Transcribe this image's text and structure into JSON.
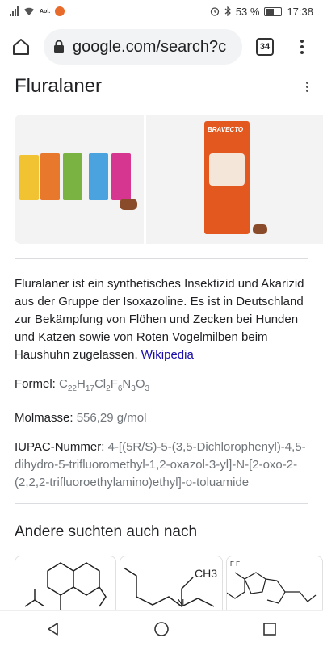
{
  "status_bar": {
    "carrier_badge": "Aol.",
    "battery_percent": "53 %",
    "battery_level": 0.53,
    "time": "17:38"
  },
  "browser": {
    "url": "google.com/search?c",
    "tab_count": "34",
    "icons": [
      "home-icon",
      "lock-icon",
      "menu-icon"
    ]
  },
  "knowledge_panel": {
    "title": "Fluralaner",
    "images": [
      {
        "name": "bravecto-product-lineup-image"
      },
      {
        "name": "bravecto-box-image",
        "brand_text": "BRAVECTO"
      }
    ],
    "description": "Fluralaner ist ein synthetisches Insektizid und Akarizid aus der Gruppe der Isoxazoline. Es ist in Deutschland zur Bekämpfung von Flöhen und Zecken bei Hunden und Katzen sowie von Roten Vogelmilben beim Haushuhn zugelassen.",
    "source_link": "Wikipedia",
    "facts": {
      "formula_label": "Formel:",
      "formula": {
        "C": "C",
        "C_n": "22",
        "H": "H",
        "H_n": "17",
        "Cl": "Cl",
        "Cl_n": "2",
        "F": "F",
        "F_n": "6",
        "N": "N",
        "N_n": "3",
        "O": "O",
        "O_n": "3"
      },
      "molmass_label": "Molmasse:",
      "molmass": "556,29 g/mol",
      "iupac_label": "IUPAC-Nummer:",
      "iupac": "4-[(5R/S)-5-(3,5-Dichlorophenyl)-4,5-dihydro-5-trifluoromethyl-1,2-oxazol-3-yl]-N-[2-oxo-2-(2,2,2-trifluoroethylamino)ethyl]-o-toluamide"
    },
    "related_title": "Andere suchten auch nach",
    "related_labels": {
      "ch3": "CH3",
      "mol3_atoms": "F F"
    }
  },
  "colors": {
    "link": "#1a0dab",
    "bravecto_orange": "#e2581f"
  }
}
